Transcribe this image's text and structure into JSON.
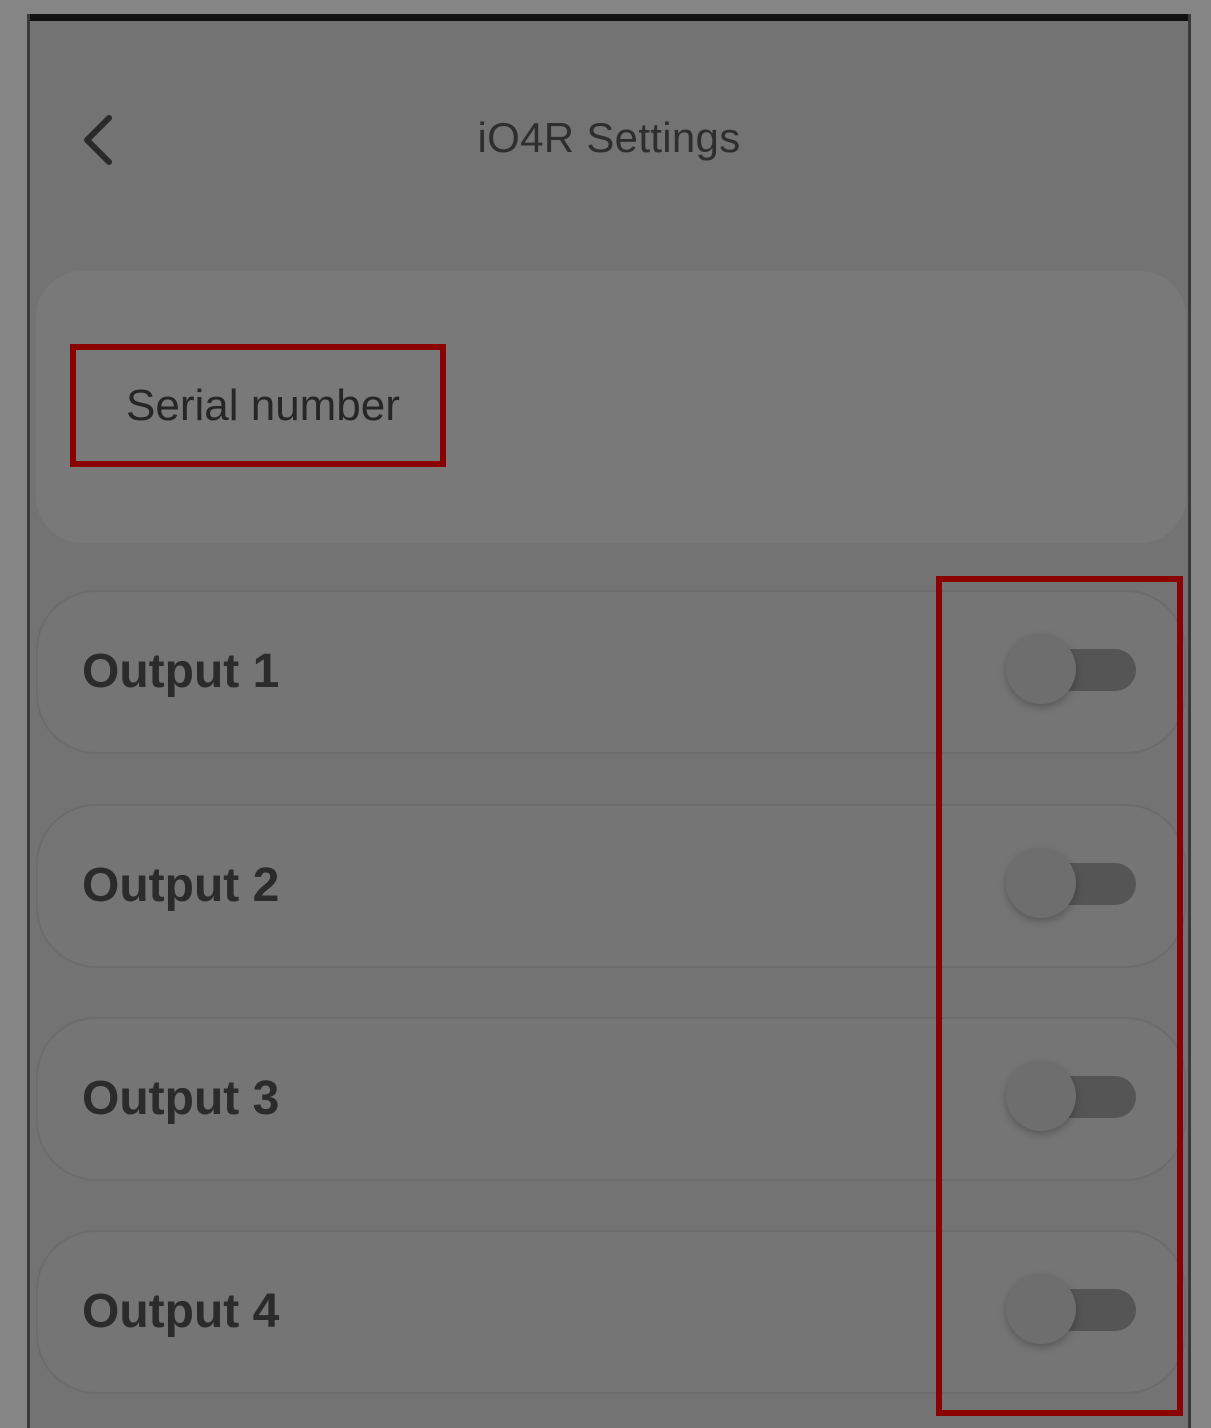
{
  "header": {
    "title": "iO4R Settings",
    "back_icon": "chevron-left-icon"
  },
  "serial": {
    "label": "Serial number"
  },
  "outputs": [
    {
      "label": "Output 1",
      "enabled": false
    },
    {
      "label": "Output 2",
      "enabled": false
    },
    {
      "label": "Output 3",
      "enabled": false
    },
    {
      "label": "Output 4",
      "enabled": false
    }
  ],
  "colors": {
    "highlight": "#8b0000",
    "toggle_track": "#555555"
  }
}
